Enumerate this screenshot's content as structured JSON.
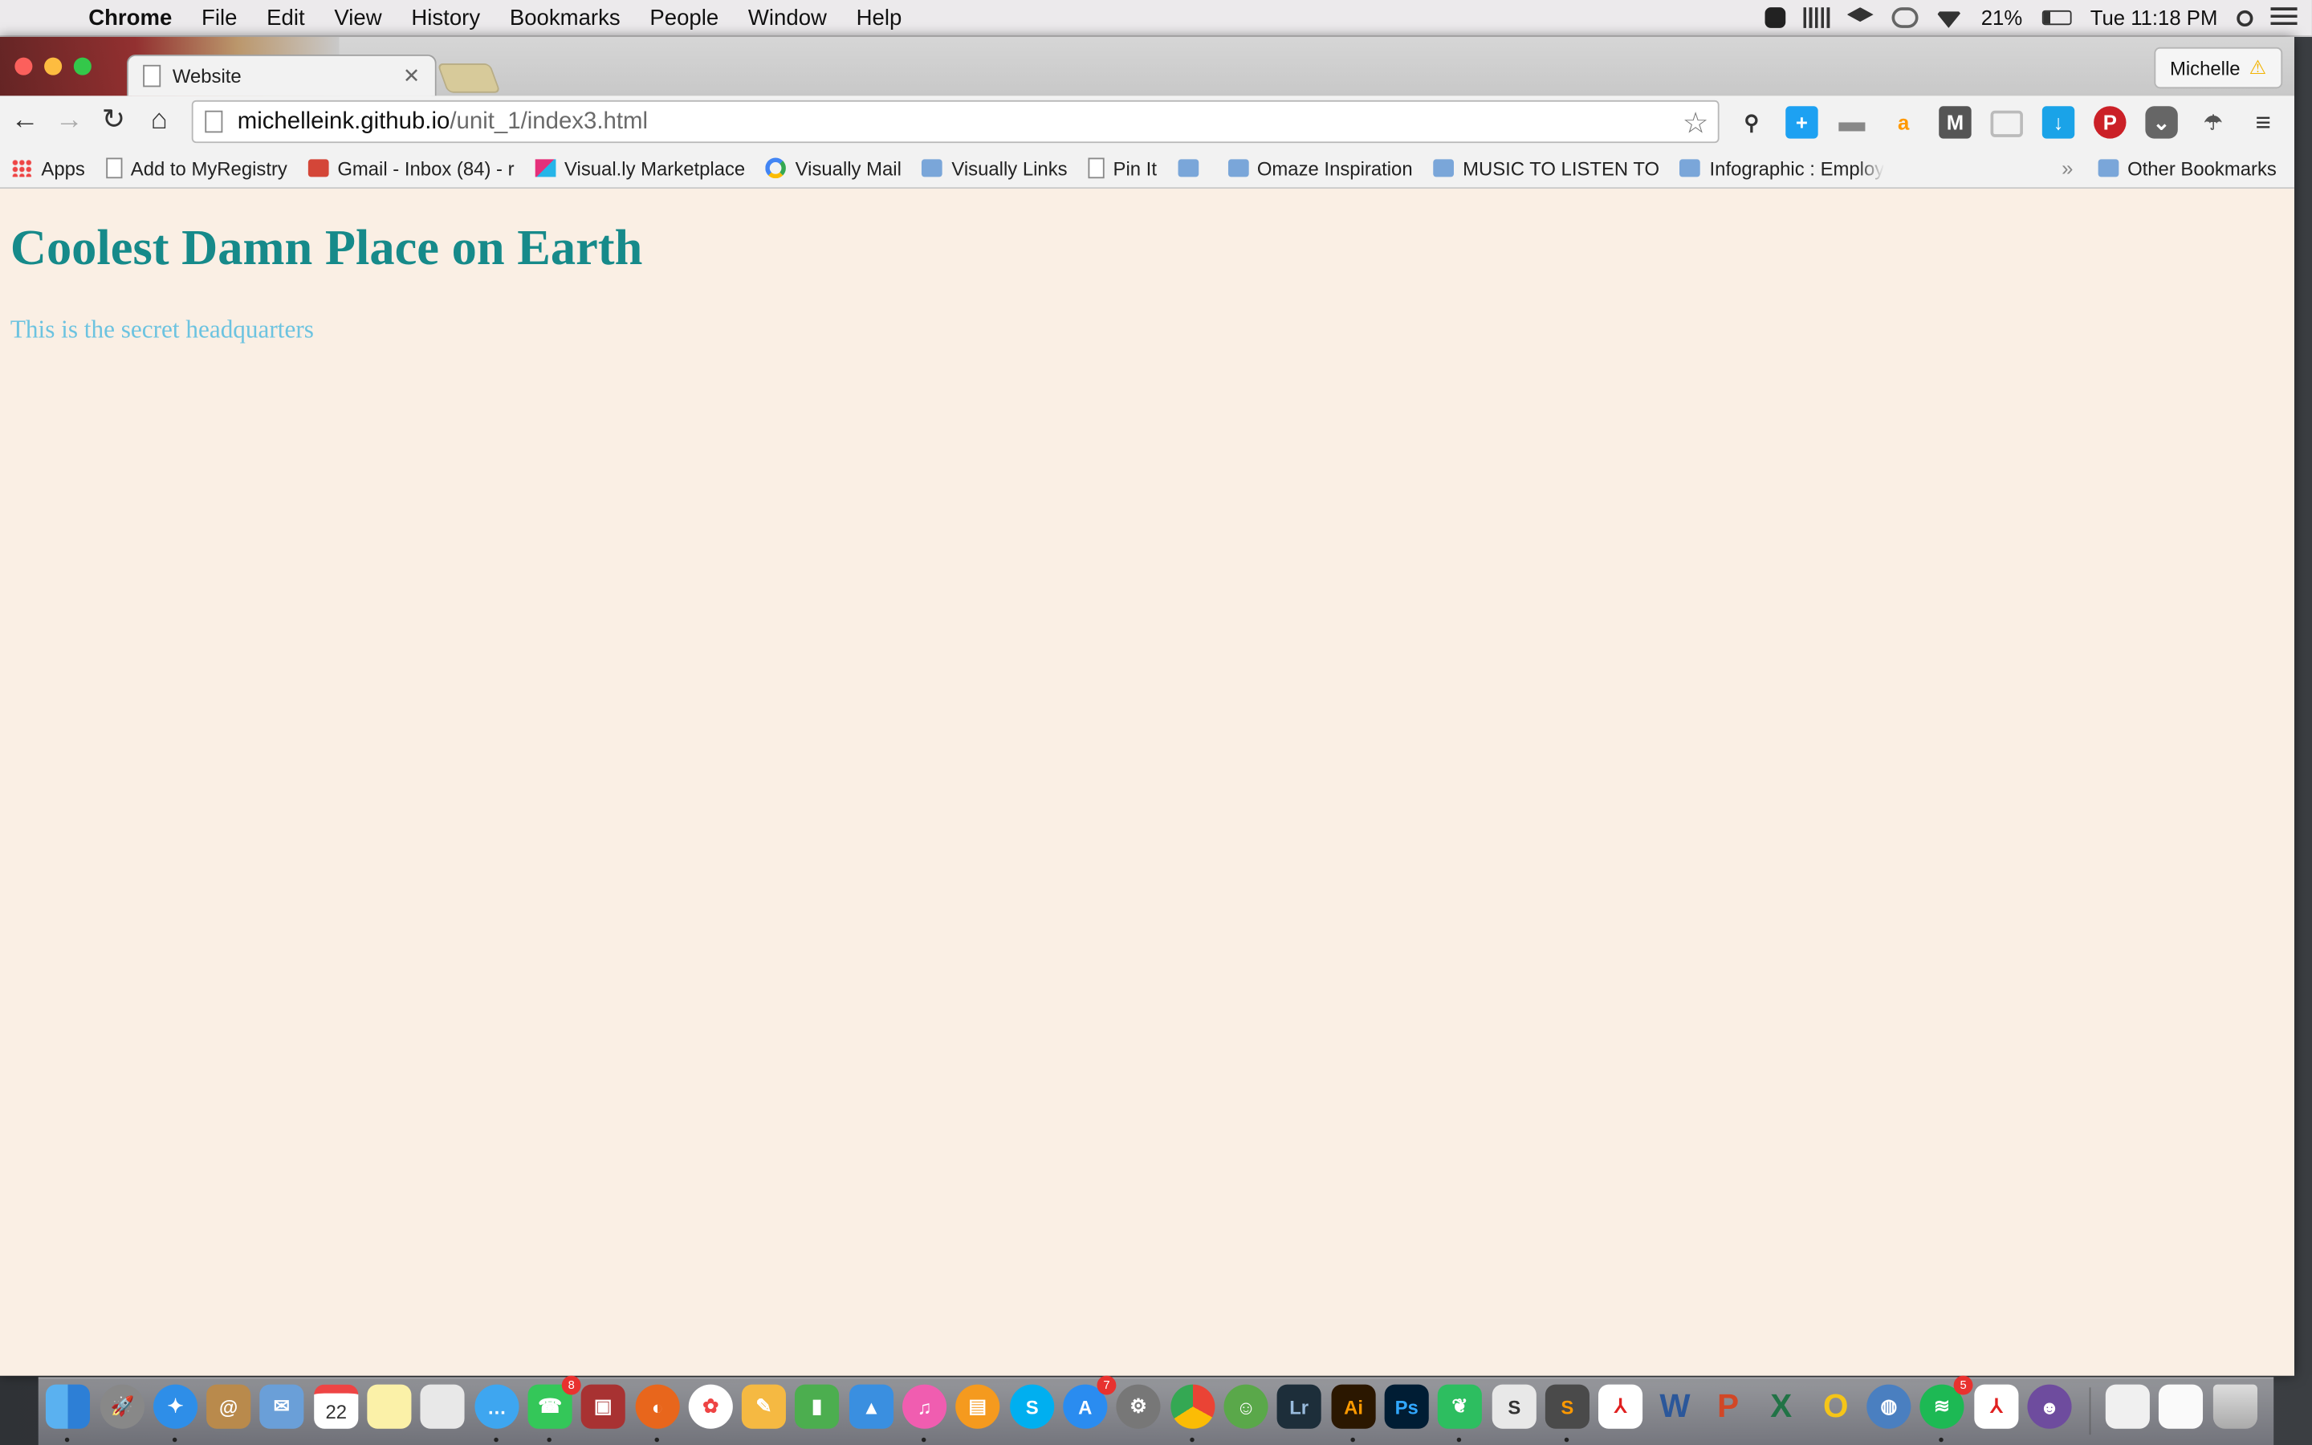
{
  "menubar": {
    "app_name": "Chrome",
    "items": [
      "File",
      "Edit",
      "View",
      "History",
      "Bookmarks",
      "People",
      "Window",
      "Help"
    ],
    "battery": "21%",
    "clock": "Tue 11:18 PM"
  },
  "browser": {
    "tab_title": "Website",
    "profile_name": "Michelle",
    "url_host": "michelleink.github.io",
    "url_path": "/unit_1/index3.html"
  },
  "bookmarks": {
    "apps": "Apps",
    "items": [
      {
        "label": "Add to MyRegistry",
        "icon": "page"
      },
      {
        "label": "Gmail - Inbox (84) - r",
        "icon": "gmail"
      },
      {
        "label": "Visual.ly Marketplace",
        "icon": "visually"
      },
      {
        "label": "Visually Mail",
        "icon": "google"
      },
      {
        "label": "Visually Links",
        "icon": "folder"
      },
      {
        "label": "Pin It",
        "icon": "page"
      },
      {
        "label": "",
        "icon": "folder"
      },
      {
        "label": "Omaze Inspiration",
        "icon": "folder"
      },
      {
        "label": "MUSIC TO LISTEN TO",
        "icon": "folder"
      },
      {
        "label": "Infographic : Employ",
        "icon": "folder"
      }
    ],
    "overflow": "»",
    "other": "Other Bookmarks"
  },
  "page": {
    "heading": "Coolest Damn Place on Earth",
    "text": "This is the secret headquarters"
  },
  "dock": {
    "badges": {
      "facetime": "8",
      "appstore": "7",
      "spotify": "5"
    }
  },
  "colors": {
    "page_bg": "#faefe4",
    "heading": "#168a8a",
    "paragraph": "#6cc3e0"
  }
}
